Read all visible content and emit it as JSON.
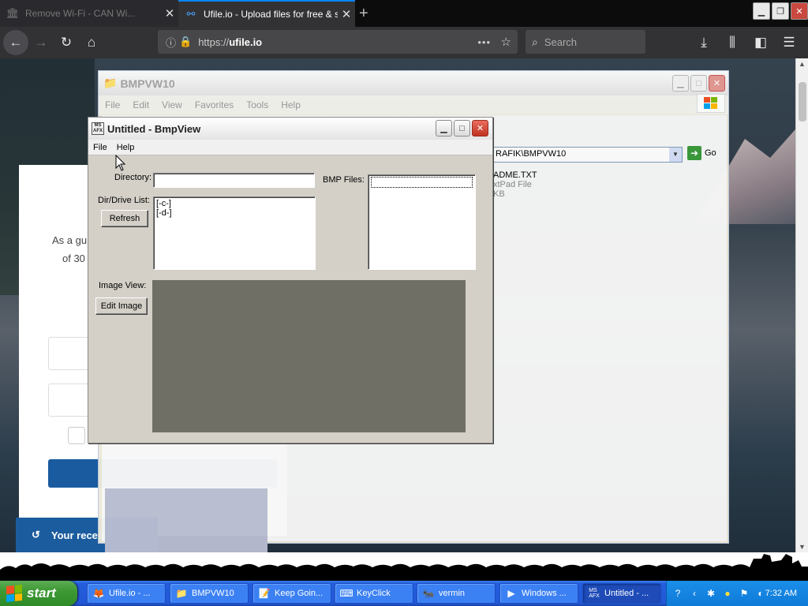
{
  "browser": {
    "tabs": [
      {
        "title": "Remove Wi-Fi - CAN Wi...",
        "active": false,
        "icon": "museum-icon"
      },
      {
        "title": "Ufile.io - Upload files for free & sh",
        "active": true,
        "icon": "ufile-icon"
      }
    ],
    "url": {
      "protocol": "https://",
      "host": "ufile.io"
    },
    "search_placeholder": "Search"
  },
  "webpage": {
    "card_line1": "As a gu",
    "card_line2": "of 30",
    "recent_label": "Your recen"
  },
  "explorer": {
    "title": "BMPVW10",
    "menu": [
      "File",
      "Edit",
      "View",
      "Favorites",
      "Tools",
      "Help"
    ],
    "address": "RAFIK\\BMPVW10",
    "go_label": "Go",
    "file_name": "ADME.TXT",
    "file_type": "xtPad File",
    "file_size": "KB"
  },
  "bmpview": {
    "title": "Untitled - BmpView",
    "menu": [
      "File",
      "Help"
    ],
    "directory_label": "Directory:",
    "directory_value": "",
    "drive_list_label": "Dir/Drive List:",
    "drive_list": [
      "[-c-]",
      "[-d-]"
    ],
    "refresh_label": "Refresh",
    "bmp_files_label": "BMP Files:",
    "bmp_files": [],
    "image_view_label": "Image View:",
    "edit_image_label": "Edit Image",
    "image_color": "#706f65"
  },
  "taskbar": {
    "start_label": "start",
    "tasks": [
      {
        "label": "Ufile.io - ...",
        "icon": "firefox-icon"
      },
      {
        "label": "BMPVW10",
        "icon": "folder-icon"
      },
      {
        "label": "Keep Goin...",
        "icon": "notepad-icon"
      },
      {
        "label": "KeyClick",
        "icon": "keyclick-icon"
      },
      {
        "label": "vermin",
        "icon": "vermin-icon"
      },
      {
        "label": "Windows ...",
        "icon": "media-icon"
      },
      {
        "label": "Untitled - ...",
        "icon": "mfc-icon",
        "active": true
      }
    ],
    "clock": "7:32 AM"
  }
}
